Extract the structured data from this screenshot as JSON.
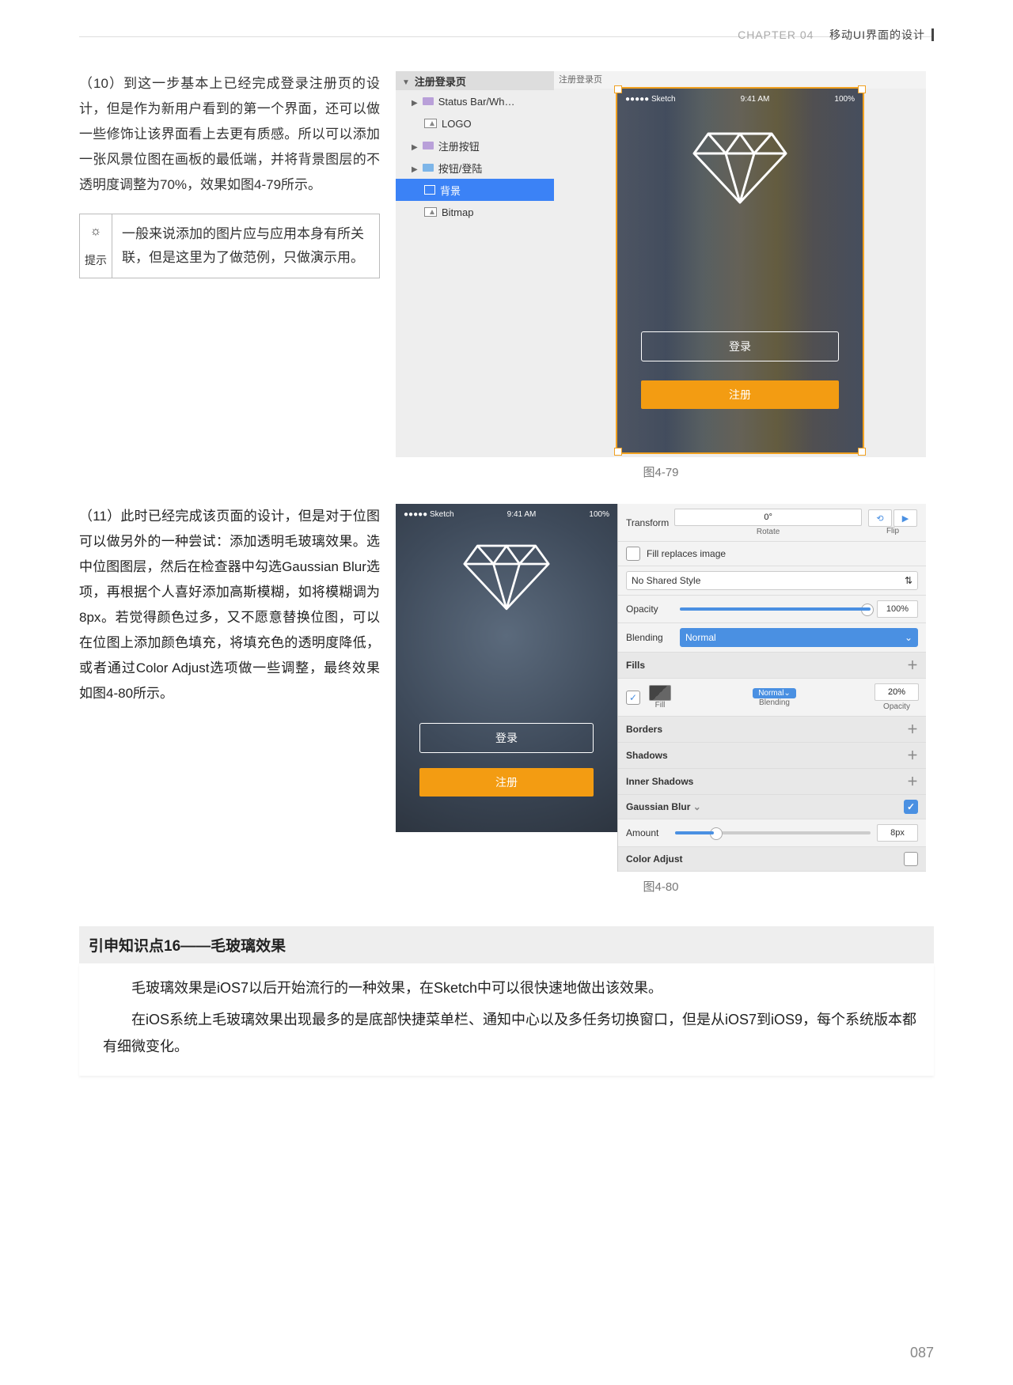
{
  "header": {
    "chapter": "CHAPTER 04",
    "title": "移动UI界面的设计"
  },
  "pageNumber": "087",
  "para10": "（10）到这一步基本上已经完成登录注册页的设计，但是作为新用户看到的第一个界面，还可以做一些修饰让该界面看上去更有质感。所以可以添加一张风景位图在画板的最低端，并将背景图层的不透明度调整为70%，效果如图4-79所示。",
  "tip": {
    "label": "提示",
    "content": "一般来说添加的图片应与应用本身有所关联，但是这里为了做范例，只做演示用。"
  },
  "figure79": {
    "panelTitle": "注册登录页",
    "layers": {
      "statusbar": "Status Bar/Wh…",
      "logo": "LOGO",
      "registerBtn": "注册按钮",
      "loginBtnFolder": "按钮/登陆",
      "background": "背景",
      "bitmap": "Bitmap"
    },
    "artboardTitle": "注册登录页",
    "status": {
      "carrier": "●●●●● Sketch",
      "time": "9:41 AM",
      "battery": "100%"
    },
    "btnLogin": "登录",
    "btnRegister": "注册",
    "caption": "图4-79"
  },
  "para11": "（11）此时已经完成该页面的设计，但是对于位图可以做另外的一种尝试：添加透明毛玻璃效果。选中位图图层，然后在检查器中勾选Gaussian Blur选项，再根据个人喜好添加高斯模糊，如将模糊调为8px。若觉得颜色过多，又不愿意替换位图，可以在位图上添加颜色填充，将填充色的透明度降低，或者通过Color Adjust选项做一些调整，最终效果如图4-80所示。",
  "figure80": {
    "status": {
      "carrier": "●●●●● Sketch",
      "time": "9:41 AM",
      "battery": "100%"
    },
    "btnLogin": "登录",
    "btnRegister": "注册",
    "inspector": {
      "transform": "Transform",
      "transformVal": "0°",
      "rotate": "Rotate",
      "flip": "Flip",
      "fillReplaces": "Fill replaces image",
      "sharedStyle": "No Shared Style",
      "opacityLabel": "Opacity",
      "opacityVal": "100%",
      "blendingLabel": "Blending",
      "blendingVal": "Normal",
      "fillsLabel": "Fills",
      "fillLabel": "Fill",
      "fillBlending": "Normal",
      "fillBlendingLabel": "Blending",
      "fillOpacity": "20%",
      "fillOpacityLabel": "Opacity",
      "bordersLabel": "Borders",
      "shadowsLabel": "Shadows",
      "innerShadowsLabel": "Inner Shadows",
      "gaussianLabel": "Gaussian Blur",
      "amountLabel": "Amount",
      "amountVal": "8px",
      "colorAdjustLabel": "Color Adjust"
    },
    "caption": "图4-80"
  },
  "knowledge": {
    "heading": "引申知识点16——毛玻璃效果",
    "p1": "毛玻璃效果是iOS7以后开始流行的一种效果，在Sketch中可以很快速地做出该效果。",
    "p2": "在iOS系统上毛玻璃效果出现最多的是底部快捷菜单栏、通知中心以及多任务切换窗口，但是从iOS7到iOS9，每个系统版本都有细微变化。"
  }
}
